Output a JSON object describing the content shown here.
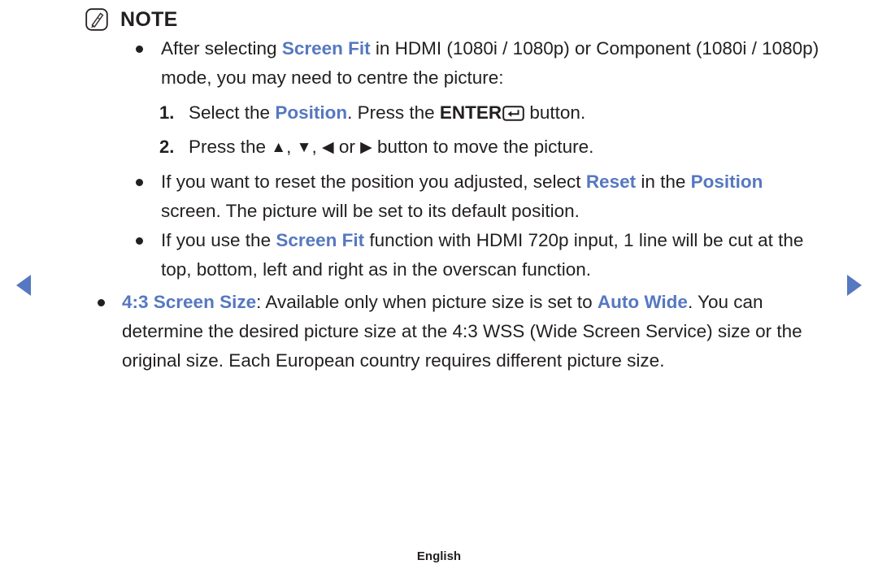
{
  "colors": {
    "accent_blue": "#5578c0",
    "body_text": "#231f20",
    "background": "#ffffff"
  },
  "note": {
    "icon_name": "note-pencil-icon",
    "title": "NOTE"
  },
  "nav": {
    "prev_label": "◀",
    "next_label": "▶"
  },
  "bullets": {
    "b1": {
      "t1": "After selecting ",
      "hl1": "Screen Fit",
      "t2": " in HDMI (1080i / 1080p) or Component (1080i / 1080p) mode, you may need to centre the picture:"
    },
    "b2": {
      "t1": "If you want to reset the position you adjusted, select ",
      "hl1": "Reset",
      "t2": " in the ",
      "hl2": "Position",
      "t3": " screen. The picture will be set to its default position."
    },
    "b3": {
      "t1": "If you use the ",
      "hl1": "Screen Fit",
      "t2": " function with HDMI 720p input, 1 line will be cut at the top, bottom, left and right as in the overscan function."
    },
    "b4": {
      "hl1": "4:3 Screen Size",
      "t1": ": Available only when picture size is set to ",
      "hl2": "Auto Wide",
      "t2": ". You can determine the desired picture size at the 4:3 WSS (Wide Screen Service) size or the original size. Each European country requires different picture size."
    }
  },
  "steps": [
    {
      "number": "1.",
      "t1": "Select the ",
      "hl1": "Position",
      "t2": ". Press the ",
      "bold1": "ENTER",
      "key_icon": "enter-key-icon",
      "t3": " button."
    },
    {
      "number": "2.",
      "t1": "Press the ",
      "up": "▲",
      "sep1": ", ",
      "down": "▼",
      "sep2": ", ",
      "left": "◀",
      "sep3": " or ",
      "right": "▶",
      "t2": " button to move the picture."
    }
  ],
  "footer": {
    "language": "English"
  }
}
